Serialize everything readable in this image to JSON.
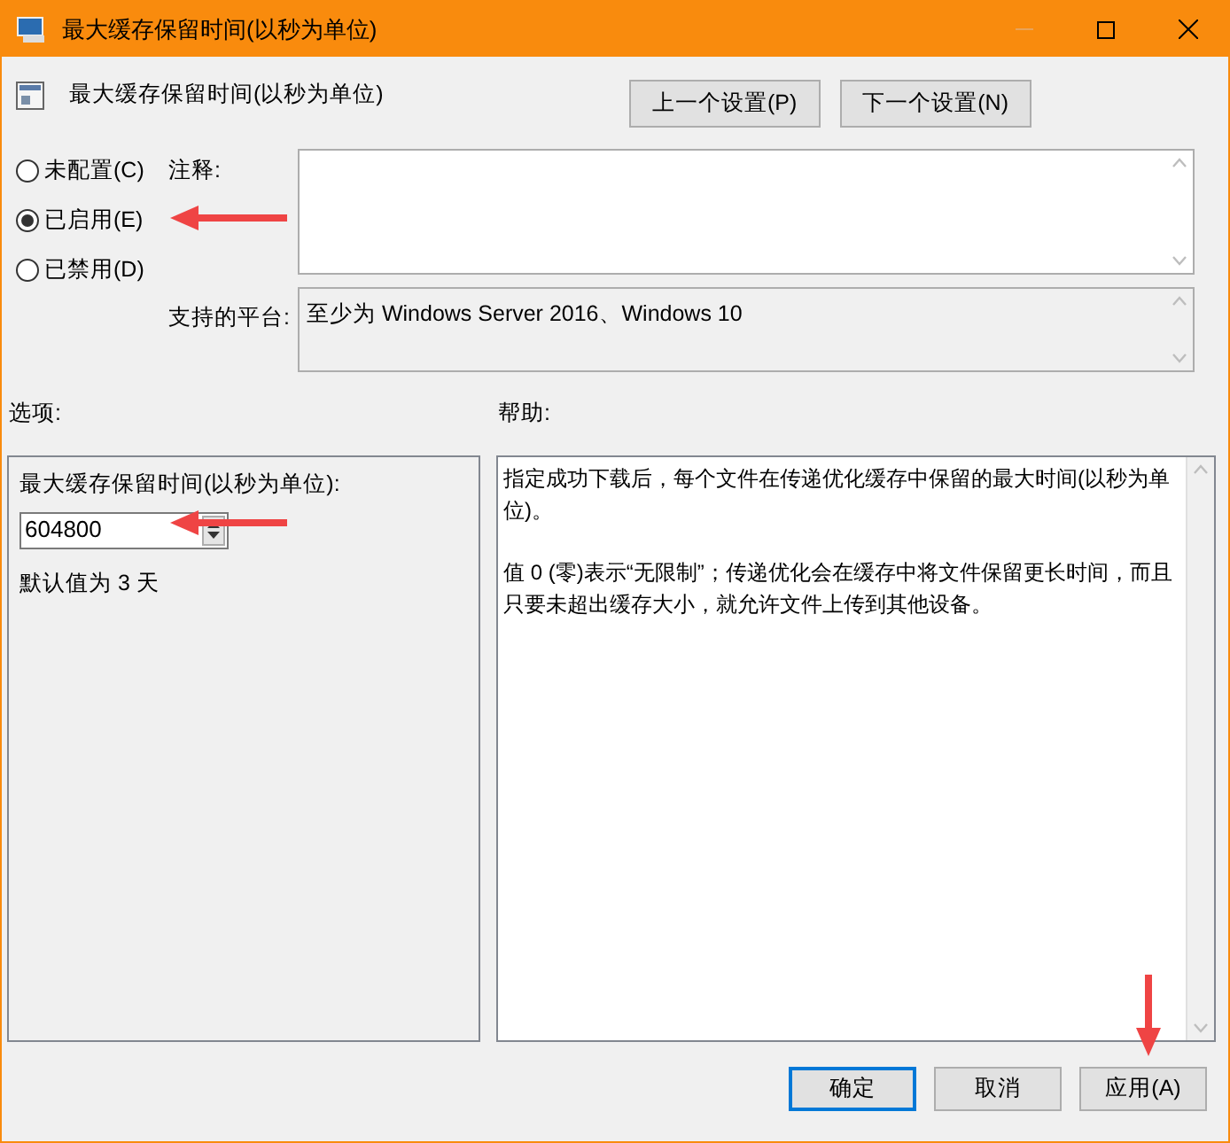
{
  "window": {
    "title": "最大缓存保留时间(以秒为单位)"
  },
  "header": {
    "title": "最大缓存保留时间(以秒为单位)",
    "buttons": [
      {
        "label": "上一个设置(P)"
      },
      {
        "label": "下一个设置(N)"
      }
    ]
  },
  "state_options": [
    {
      "label": "未配置(C)",
      "selected": false
    },
    {
      "label": "已启用(E)",
      "selected": true
    },
    {
      "label": "已禁用(D)",
      "selected": false
    }
  ],
  "comment": {
    "label": "注释:"
  },
  "platform": {
    "label": "支持的平台:",
    "value": "至少为 Windows Server 2016、Windows 10"
  },
  "options": {
    "label": "选项:",
    "field_label": "最大缓存保留时间(以秒为单位):",
    "value": "604800",
    "note": "默认值为 3 天"
  },
  "help": {
    "label": "帮助:",
    "paragraphs": [
      "指定成功下载后，每个文件在传递优化缓存中保留的最大时间(以秒为单位)。",
      "值 0 (零)表示“无限制”；传递优化会在缓存中将文件保留更长时间，而且只要未超出缓存大小，就允许文件上传到其他设备。"
    ]
  },
  "buttons": [
    {
      "label": "确定",
      "default": true
    },
    {
      "label": "取消",
      "default": false
    },
    {
      "label": "应用(A)",
      "default": false
    }
  ]
}
